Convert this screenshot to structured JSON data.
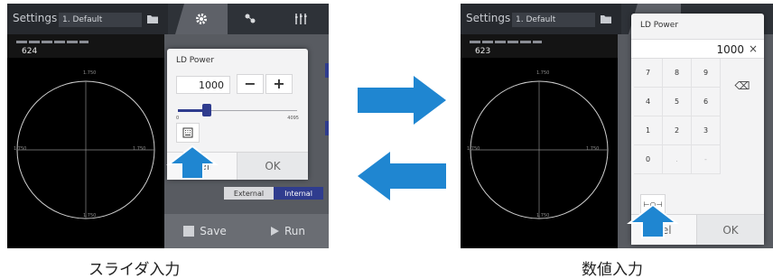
{
  "topbar": {
    "settings_label": "Settings",
    "preset_value": "1. Default"
  },
  "left_screen": {
    "readout_value": "624",
    "axis_top": "1.750",
    "axis_left": "1.750",
    "axis_right": "1.750",
    "axis_bottom": "1.750",
    "side": {
      "segment_external": "External",
      "segment_internal": "Internal",
      "save_label": "Save",
      "run_label": "Run"
    },
    "slider_dialog": {
      "title": "LD Power",
      "value": "1000",
      "minus_label": "−",
      "plus_label": "+",
      "min_label": "0",
      "max_label": "4095",
      "slider_fraction": 0.244,
      "cancel_label": "cel",
      "ok_label": "OK"
    }
  },
  "right_screen": {
    "readout_value": "623",
    "axis_top": "1.750",
    "axis_left": "1.750",
    "axis_right": "1.750",
    "axis_bottom": "1.750",
    "keypad_dialog": {
      "title": "LD Power",
      "value": "1000",
      "clear_label": "×",
      "keys": [
        "7",
        "8",
        "9",
        "4",
        "5",
        "6",
        "1",
        "2",
        "3",
        "0",
        ".",
        "-"
      ],
      "backspace_label": "⌫",
      "slider_toggle_label": "⊢○⊣",
      "cancel_label": "cel",
      "ok_label": "OK"
    }
  },
  "captions": {
    "left": "スライダ入力",
    "right": "数値入力"
  },
  "colors": {
    "accent": "#2f3c8e",
    "arrow": "#1f86d1"
  }
}
